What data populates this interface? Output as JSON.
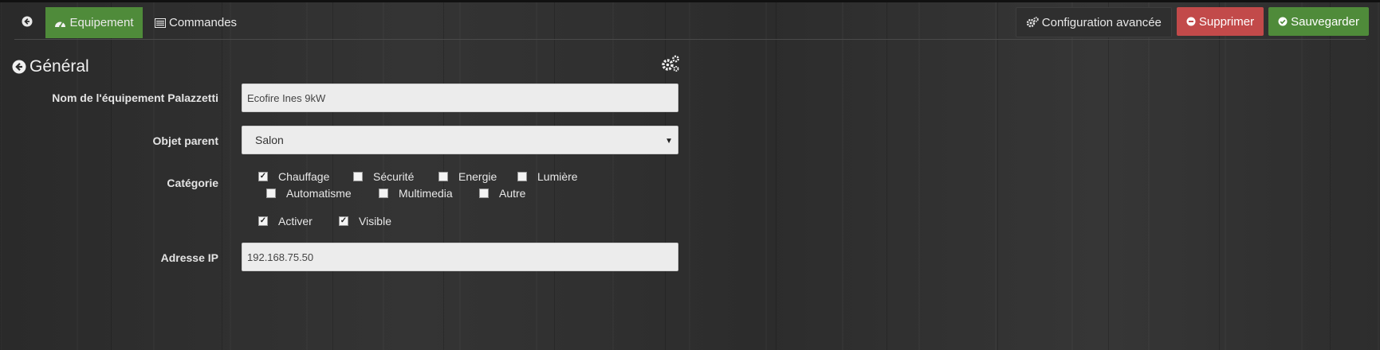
{
  "tabs": {
    "back_icon": "arrow-circle-left-icon",
    "equipement": {
      "label": "Equipement",
      "icon": "dashboard-icon"
    },
    "commandes": {
      "label": "Commandes",
      "icon": "list-alt-icon"
    }
  },
  "actions": {
    "config": {
      "label": "Configuration avancée",
      "icon": "cogs-icon"
    },
    "delete": {
      "label": "Supprimer",
      "icon": "minus-circle-icon",
      "color": "#c24a4a"
    },
    "save": {
      "label": "Sauvegarder",
      "icon": "check-circle-icon",
      "color": "#4f8b3a"
    }
  },
  "section": {
    "title": "Général",
    "icon": "arrow-circle-left-icon",
    "settings_icon": "cogs-icon"
  },
  "form": {
    "name": {
      "label": "Nom de l'équipement Palazzetti",
      "value": "Ecofire Ines 9kW"
    },
    "parent": {
      "label": "Objet parent",
      "value": "Salon"
    },
    "category": {
      "label": "Catégorie",
      "options": [
        {
          "label": "Chauffage",
          "checked": true
        },
        {
          "label": "Sécurité",
          "checked": false
        },
        {
          "label": "Energie",
          "checked": false
        },
        {
          "label": "Lumière",
          "checked": false
        },
        {
          "label": "Automatisme",
          "checked": false
        },
        {
          "label": "Multimedia",
          "checked": false
        },
        {
          "label": "Autre",
          "checked": false
        }
      ]
    },
    "activer": {
      "label": "Activer",
      "checked": true
    },
    "visible": {
      "label": "Visible",
      "checked": true
    },
    "ip": {
      "label": "Adresse IP",
      "value": "192.168.75.50"
    }
  }
}
